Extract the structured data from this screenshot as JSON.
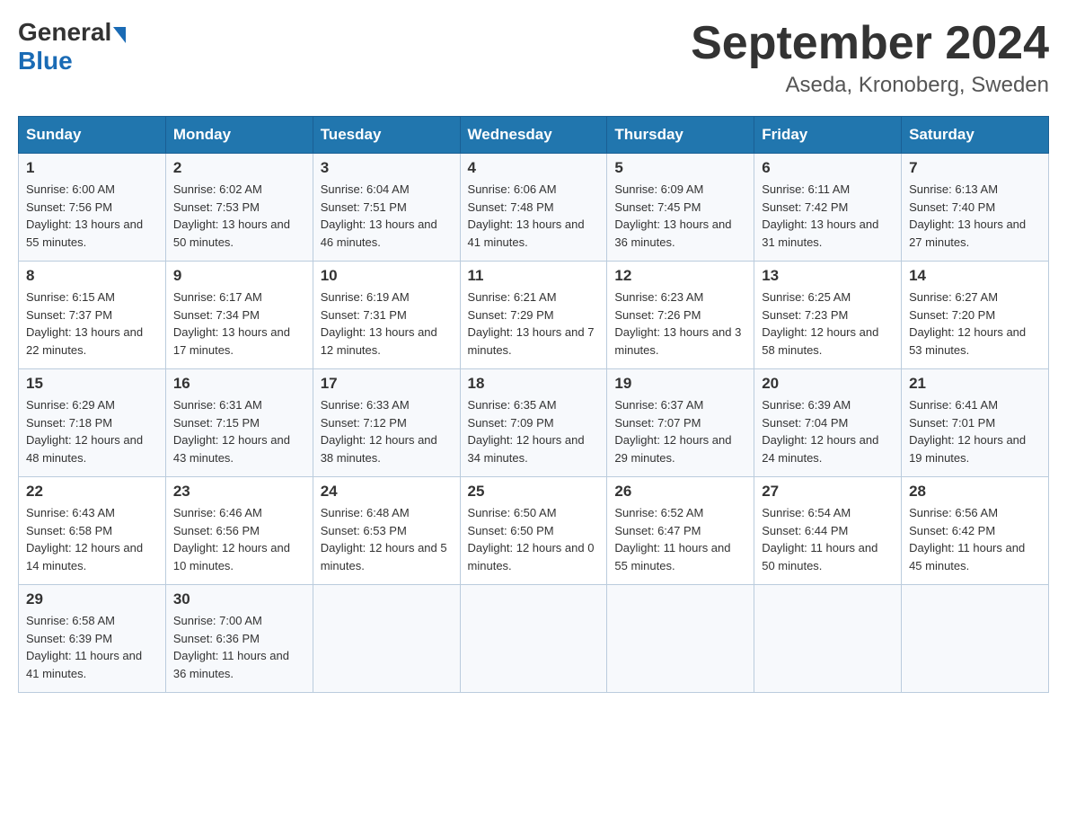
{
  "header": {
    "logo_general": "General",
    "logo_blue": "Blue",
    "month_title": "September 2024",
    "location": "Aseda, Kronoberg, Sweden"
  },
  "days_of_week": [
    "Sunday",
    "Monday",
    "Tuesday",
    "Wednesday",
    "Thursday",
    "Friday",
    "Saturday"
  ],
  "weeks": [
    [
      {
        "day": "1",
        "sunrise": "6:00 AM",
        "sunset": "7:56 PM",
        "daylight": "13 hours and 55 minutes."
      },
      {
        "day": "2",
        "sunrise": "6:02 AM",
        "sunset": "7:53 PM",
        "daylight": "13 hours and 50 minutes."
      },
      {
        "day": "3",
        "sunrise": "6:04 AM",
        "sunset": "7:51 PM",
        "daylight": "13 hours and 46 minutes."
      },
      {
        "day": "4",
        "sunrise": "6:06 AM",
        "sunset": "7:48 PM",
        "daylight": "13 hours and 41 minutes."
      },
      {
        "day": "5",
        "sunrise": "6:09 AM",
        "sunset": "7:45 PM",
        "daylight": "13 hours and 36 minutes."
      },
      {
        "day": "6",
        "sunrise": "6:11 AM",
        "sunset": "7:42 PM",
        "daylight": "13 hours and 31 minutes."
      },
      {
        "day": "7",
        "sunrise": "6:13 AM",
        "sunset": "7:40 PM",
        "daylight": "13 hours and 27 minutes."
      }
    ],
    [
      {
        "day": "8",
        "sunrise": "6:15 AM",
        "sunset": "7:37 PM",
        "daylight": "13 hours and 22 minutes."
      },
      {
        "day": "9",
        "sunrise": "6:17 AM",
        "sunset": "7:34 PM",
        "daylight": "13 hours and 17 minutes."
      },
      {
        "day": "10",
        "sunrise": "6:19 AM",
        "sunset": "7:31 PM",
        "daylight": "13 hours and 12 minutes."
      },
      {
        "day": "11",
        "sunrise": "6:21 AM",
        "sunset": "7:29 PM",
        "daylight": "13 hours and 7 minutes."
      },
      {
        "day": "12",
        "sunrise": "6:23 AM",
        "sunset": "7:26 PM",
        "daylight": "13 hours and 3 minutes."
      },
      {
        "day": "13",
        "sunrise": "6:25 AM",
        "sunset": "7:23 PM",
        "daylight": "12 hours and 58 minutes."
      },
      {
        "day": "14",
        "sunrise": "6:27 AM",
        "sunset": "7:20 PM",
        "daylight": "12 hours and 53 minutes."
      }
    ],
    [
      {
        "day": "15",
        "sunrise": "6:29 AM",
        "sunset": "7:18 PM",
        "daylight": "12 hours and 48 minutes."
      },
      {
        "day": "16",
        "sunrise": "6:31 AM",
        "sunset": "7:15 PM",
        "daylight": "12 hours and 43 minutes."
      },
      {
        "day": "17",
        "sunrise": "6:33 AM",
        "sunset": "7:12 PM",
        "daylight": "12 hours and 38 minutes."
      },
      {
        "day": "18",
        "sunrise": "6:35 AM",
        "sunset": "7:09 PM",
        "daylight": "12 hours and 34 minutes."
      },
      {
        "day": "19",
        "sunrise": "6:37 AM",
        "sunset": "7:07 PM",
        "daylight": "12 hours and 29 minutes."
      },
      {
        "day": "20",
        "sunrise": "6:39 AM",
        "sunset": "7:04 PM",
        "daylight": "12 hours and 24 minutes."
      },
      {
        "day": "21",
        "sunrise": "6:41 AM",
        "sunset": "7:01 PM",
        "daylight": "12 hours and 19 minutes."
      }
    ],
    [
      {
        "day": "22",
        "sunrise": "6:43 AM",
        "sunset": "6:58 PM",
        "daylight": "12 hours and 14 minutes."
      },
      {
        "day": "23",
        "sunrise": "6:46 AM",
        "sunset": "6:56 PM",
        "daylight": "12 hours and 10 minutes."
      },
      {
        "day": "24",
        "sunrise": "6:48 AM",
        "sunset": "6:53 PM",
        "daylight": "12 hours and 5 minutes."
      },
      {
        "day": "25",
        "sunrise": "6:50 AM",
        "sunset": "6:50 PM",
        "daylight": "12 hours and 0 minutes."
      },
      {
        "day": "26",
        "sunrise": "6:52 AM",
        "sunset": "6:47 PM",
        "daylight": "11 hours and 55 minutes."
      },
      {
        "day": "27",
        "sunrise": "6:54 AM",
        "sunset": "6:44 PM",
        "daylight": "11 hours and 50 minutes."
      },
      {
        "day": "28",
        "sunrise": "6:56 AM",
        "sunset": "6:42 PM",
        "daylight": "11 hours and 45 minutes."
      }
    ],
    [
      {
        "day": "29",
        "sunrise": "6:58 AM",
        "sunset": "6:39 PM",
        "daylight": "11 hours and 41 minutes."
      },
      {
        "day": "30",
        "sunrise": "7:00 AM",
        "sunset": "6:36 PM",
        "daylight": "11 hours and 36 minutes."
      },
      null,
      null,
      null,
      null,
      null
    ]
  ],
  "labels": {
    "sunrise": "Sunrise:",
    "sunset": "Sunset:",
    "daylight": "Daylight:"
  }
}
